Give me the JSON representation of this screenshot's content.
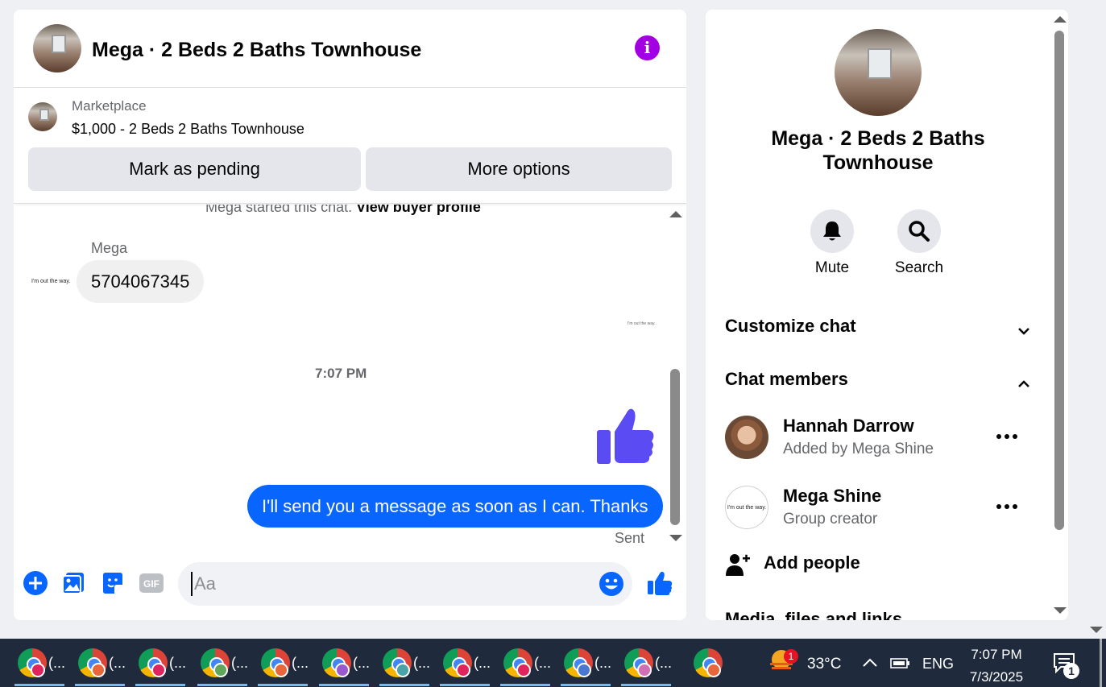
{
  "chat": {
    "title": "Mega · 2 Beds 2 Baths Townhouse",
    "info_icon": "info-icon",
    "marketplace": {
      "label": "Marketplace",
      "listing": "$1,000 - 2 Beds 2 Baths Townhouse",
      "pending_button": "Mark as pending",
      "more_button": "More options"
    },
    "messages": {
      "started_prefix": "Mega started this chat.",
      "view_buyer": "View buyer profile",
      "sender": "Mega",
      "avatar_text": "I'm out the way.",
      "incoming": "5704067345",
      "seen_text": "I'm out the way.",
      "time": "7:07 PM",
      "outgoing": "I'll send you a message as soon as I can. Thanks",
      "status": "Sent"
    },
    "composer": {
      "placeholder": "Aa",
      "icons": [
        "plus-icon",
        "photo-icon",
        "sticker-icon",
        "gif-icon",
        "emoji-icon",
        "like-icon"
      ],
      "gif_label": "GIF"
    }
  },
  "details": {
    "title": "Mega · 2 Beds 2 Baths Townhouse",
    "actions": {
      "mute": "Mute",
      "search": "Search"
    },
    "customize": "Customize chat",
    "members_heading": "Chat members",
    "members": [
      {
        "name": "Hannah Darrow",
        "sub": "Added by Mega Shine"
      },
      {
        "name": "Mega Shine",
        "sub": "Group creator",
        "avatar_text": "I'm out the way."
      }
    ],
    "add_people": "Add people",
    "media": "Media, files and links"
  },
  "taskbar": {
    "app_labels": [
      "(...",
      "(...",
      "(...",
      "(...",
      "(...",
      "(...",
      "(...",
      "(...",
      "(...",
      "(...",
      "(..."
    ],
    "profile_colors": [
      "#e0245e",
      "#e8663b",
      "#e0245e",
      "#5fa55a",
      "#e8663b",
      "#9b59d0",
      "#4aa3a6",
      "#e0245e",
      "#e0245e",
      "#4a78d0",
      "#d06fb5",
      "#e8663b"
    ],
    "weather_badge": "1",
    "temperature": "33°C",
    "language": "ENG",
    "time": "7:07 PM",
    "date": "7/3/2025",
    "notification_count": "1"
  }
}
